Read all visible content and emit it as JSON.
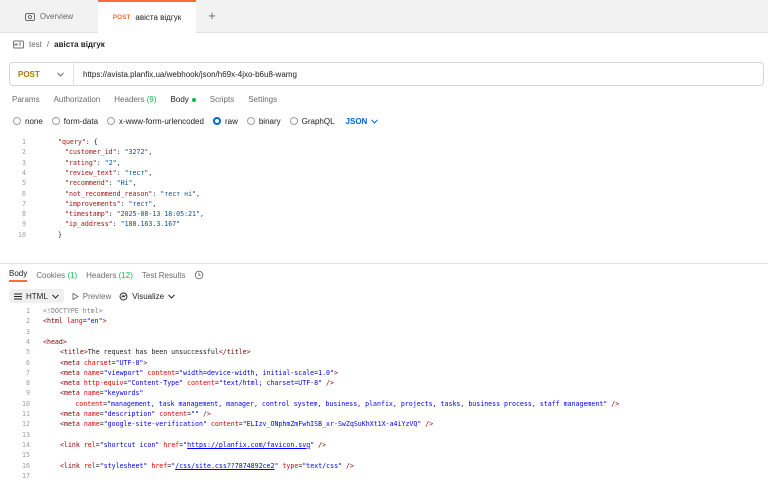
{
  "tabs": {
    "overview_label": "Overview",
    "active_method": "POST",
    "active_label": "авіста відгук",
    "add_label": "+"
  },
  "breadcrumb": {
    "parent": "test",
    "separator": "/",
    "current": "авіста відгук"
  },
  "request": {
    "method": "POST",
    "url": "https://avista.planfix.ua/webhook/json/h69x-4jxo-b6u8-wamg"
  },
  "request_tabs": [
    "Params",
    "Authorization",
    "Headers",
    "(9)",
    "Body",
    "Scripts",
    "Settings"
  ],
  "body_types": {
    "none": "none",
    "form_data": "form-data",
    "urlencoded": "x-www-form-urlencoded",
    "raw": "raw",
    "binary": "binary",
    "graphql": "GraphQL",
    "format": "JSON"
  },
  "request_body": {
    "line_numbers": [
      "1",
      "2",
      "3",
      "4",
      "5",
      "6",
      "7",
      "8",
      "9",
      "10"
    ],
    "lines": [
      [
        "\"query\"",
        ": {"
      ],
      [
        "\"customer_id\"",
        ": ",
        "\"3272\"",
        ","
      ],
      [
        "\"rating\"",
        ": ",
        "\"2\"",
        ","
      ],
      [
        "\"review_text\"",
        ": ",
        "\"тест\"",
        ","
      ],
      [
        "\"recommend\"",
        ": ",
        "\"Ні\"",
        ","
      ],
      [
        "\"not_recommend_reason\"",
        ": ",
        "\"тест ні\"",
        ","
      ],
      [
        "\"improvements\"",
        ": ",
        "\"тест\"",
        ","
      ],
      [
        "\"timestamp\"",
        ": ",
        "\"2025-08-13 18:05:21\"",
        ","
      ],
      [
        "\"ip_address\"",
        ": ",
        "\"188.163.3.167\""
      ],
      [
        "}"
      ]
    ]
  },
  "response_tabs": {
    "body": "Body",
    "cookies": "Cookies",
    "cookies_count": "(1)",
    "headers": "Headers",
    "headers_count": "(12)",
    "test_results": "Test Results"
  },
  "response_tools": {
    "format": "HTML",
    "preview": "Preview",
    "visualize": "Visualize"
  },
  "response_body": {
    "line_numbers": [
      "1",
      "2",
      "3",
      "4",
      "5",
      "6",
      "7",
      "8",
      "9",
      "10",
      "11",
      "12",
      "13",
      "14",
      "15",
      "16",
      "17"
    ],
    "l1": "<!DOCTYPE html>",
    "l2_open": "<html ",
    "l2_attr": "lang",
    "l2_val": "\"en\"",
    "l2_close": ">",
    "l4": "<head>",
    "l5_open": "<title>",
    "l5_text": "The request has been unsuccessful",
    "l5_close": "</title>",
    "l6_a": "<meta ",
    "l6_attr": "charset",
    "l6_val": "\"UTF-8\"",
    "l6_b": ">",
    "l7_a": "<meta ",
    "l7_attr1": "name",
    "l7_val1": "\"viewport\"",
    "l7_attr2": "content",
    "l7_val2": "\"width=device-width, initial-scale=1.0\"",
    "l7_b": ">",
    "l8_a": "<meta ",
    "l8_attr1": "http-equiv",
    "l8_val1": "\"Content-Type\"",
    "l8_attr2": "content",
    "l8_val2": "\"text/html; charset=UTF-8\"",
    "l8_b": " />",
    "l9_a": "<meta ",
    "l9_attr1": "name",
    "l9_val1": "\"keywords\"",
    "l10_attr": "content",
    "l10_val": "\"management, task management, manager, control system, business, planfix, projects, tasks, business process, staff management\"",
    "l10_b": " />",
    "l11_a": "<meta ",
    "l11_attr1": "name",
    "l11_val1": "\"description\"",
    "l11_attr2": "content",
    "l11_val2": "\"\"",
    "l11_b": " />",
    "l12_a": "<meta ",
    "l12_attr1": "name",
    "l12_val1": "\"google-site-verification\"",
    "l12_attr2": "content",
    "l12_val2": "\"ELIzv_ONphmZmFwhISB_xr-SwZqSuKhXt1X-a4iYzVQ\"",
    "l12_b": " />",
    "l14_a": "<link ",
    "l14_attr1": "rel",
    "l14_val1": "\"shortcut icon\"",
    "l14_attr2": "href",
    "l14_q1": "\"",
    "l14_link": "https://planfix.com/favicon.svg",
    "l14_q2": "\"",
    "l14_b": " />",
    "l16_a": "<link ",
    "l16_attr1": "rel",
    "l16_val1": "\"stylesheet\"",
    "l16_attr2": "href",
    "l16_q1": "\"",
    "l16_link": "/css/site.css??7874892ce2",
    "l16_q2": "\"",
    "l16_attr3": "type",
    "l16_val3": "\"text/css\"",
    "l16_b": " />"
  },
  "colors": {
    "accent": "#ff6c37",
    "post_method": "#ad7a03",
    "link_blue": "#0265d2",
    "success_green": "#0cbb52"
  }
}
